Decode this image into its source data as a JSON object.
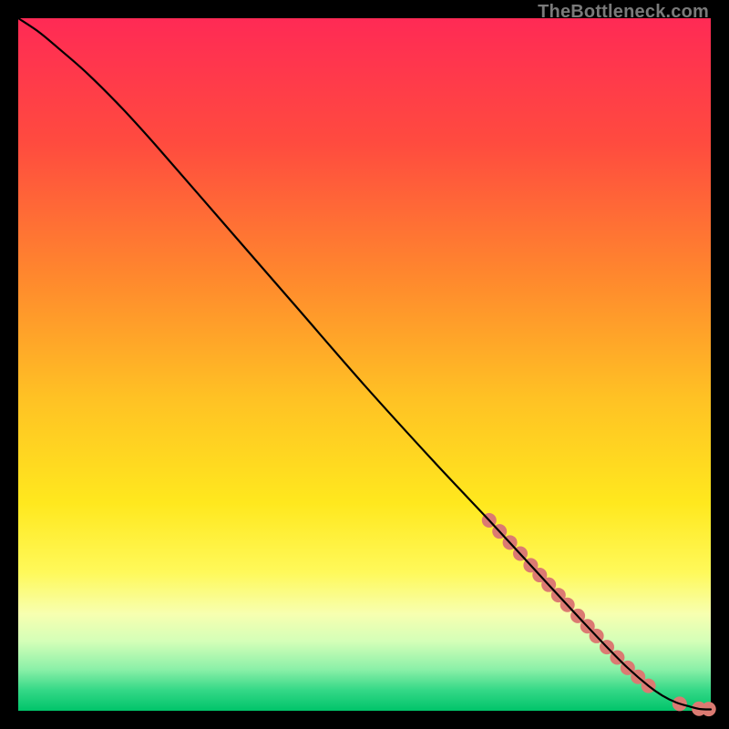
{
  "watermark": "TheBottleneck.com",
  "chart_data": {
    "type": "line",
    "title": "",
    "xlabel": "",
    "ylabel": "",
    "xlim": [
      0,
      100
    ],
    "ylim": [
      0,
      100
    ],
    "background_gradient": {
      "stops": [
        {
          "pct": 0,
          "color": "#ff2a55"
        },
        {
          "pct": 18,
          "color": "#ff4b3f"
        },
        {
          "pct": 38,
          "color": "#ff8a2d"
        },
        {
          "pct": 55,
          "color": "#ffc224"
        },
        {
          "pct": 70,
          "color": "#ffe81e"
        },
        {
          "pct": 80,
          "color": "#fff95a"
        },
        {
          "pct": 86,
          "color": "#f7ffb0"
        },
        {
          "pct": 90,
          "color": "#d4ffb8"
        },
        {
          "pct": 94,
          "color": "#8bf0a8"
        },
        {
          "pct": 97,
          "color": "#35d887"
        },
        {
          "pct": 100,
          "color": "#00c46a"
        }
      ]
    },
    "series": [
      {
        "name": "bottleneck-curve",
        "color": "#000000",
        "x": [
          0,
          3,
          6,
          10,
          15,
          20,
          30,
          40,
          50,
          60,
          68,
          74,
          80,
          85,
          88,
          91,
          93,
          95,
          97,
          98.5,
          100
        ],
        "y": [
          100,
          98,
          95.5,
          92,
          87,
          81.5,
          70,
          58.5,
          47,
          36,
          27.5,
          21,
          14.5,
          9.2,
          6.2,
          3.6,
          2.2,
          1.2,
          0.6,
          0.25,
          0.2
        ]
      }
    ],
    "markers": {
      "name": "highlight-dots",
      "color": "#db7a72",
      "radius_px": 8,
      "points": [
        {
          "x": 68,
          "y": 27.5
        },
        {
          "x": 69.5,
          "y": 25.9
        },
        {
          "x": 71,
          "y": 24.3
        },
        {
          "x": 72.5,
          "y": 22.7
        },
        {
          "x": 74,
          "y": 21.0
        },
        {
          "x": 75.3,
          "y": 19.6
        },
        {
          "x": 76.6,
          "y": 18.2
        },
        {
          "x": 78,
          "y": 16.7
        },
        {
          "x": 79.3,
          "y": 15.3
        },
        {
          "x": 80.8,
          "y": 13.7
        },
        {
          "x": 82.2,
          "y": 12.2
        },
        {
          "x": 83.5,
          "y": 10.8
        },
        {
          "x": 85,
          "y": 9.2
        },
        {
          "x": 86.5,
          "y": 7.7
        },
        {
          "x": 88,
          "y": 6.2
        },
        {
          "x": 89.5,
          "y": 4.9
        },
        {
          "x": 91,
          "y": 3.6
        },
        {
          "x": 95.5,
          "y": 1.0
        },
        {
          "x": 98.3,
          "y": 0.3
        },
        {
          "x": 99.7,
          "y": 0.25
        }
      ]
    }
  }
}
